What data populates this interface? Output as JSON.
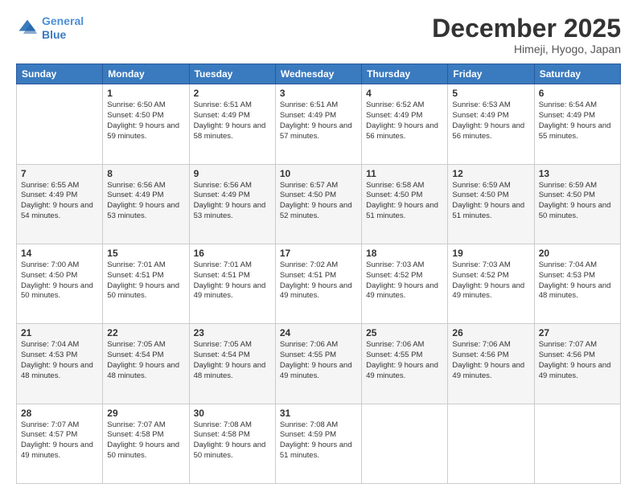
{
  "logo": {
    "line1": "General",
    "line2": "Blue"
  },
  "header": {
    "month": "December 2025",
    "location": "Himeji, Hyogo, Japan"
  },
  "weekdays": [
    "Sunday",
    "Monday",
    "Tuesday",
    "Wednesday",
    "Thursday",
    "Friday",
    "Saturday"
  ],
  "weeks": [
    [
      {
        "day": "",
        "sunrise": "",
        "sunset": "",
        "daylight": ""
      },
      {
        "day": "1",
        "sunrise": "Sunrise: 6:50 AM",
        "sunset": "Sunset: 4:50 PM",
        "daylight": "Daylight: 9 hours and 59 minutes."
      },
      {
        "day": "2",
        "sunrise": "Sunrise: 6:51 AM",
        "sunset": "Sunset: 4:49 PM",
        "daylight": "Daylight: 9 hours and 58 minutes."
      },
      {
        "day": "3",
        "sunrise": "Sunrise: 6:51 AM",
        "sunset": "Sunset: 4:49 PM",
        "daylight": "Daylight: 9 hours and 57 minutes."
      },
      {
        "day": "4",
        "sunrise": "Sunrise: 6:52 AM",
        "sunset": "Sunset: 4:49 PM",
        "daylight": "Daylight: 9 hours and 56 minutes."
      },
      {
        "day": "5",
        "sunrise": "Sunrise: 6:53 AM",
        "sunset": "Sunset: 4:49 PM",
        "daylight": "Daylight: 9 hours and 56 minutes."
      },
      {
        "day": "6",
        "sunrise": "Sunrise: 6:54 AM",
        "sunset": "Sunset: 4:49 PM",
        "daylight": "Daylight: 9 hours and 55 minutes."
      }
    ],
    [
      {
        "day": "7",
        "sunrise": "Sunrise: 6:55 AM",
        "sunset": "Sunset: 4:49 PM",
        "daylight": "Daylight: 9 hours and 54 minutes."
      },
      {
        "day": "8",
        "sunrise": "Sunrise: 6:56 AM",
        "sunset": "Sunset: 4:49 PM",
        "daylight": "Daylight: 9 hours and 53 minutes."
      },
      {
        "day": "9",
        "sunrise": "Sunrise: 6:56 AM",
        "sunset": "Sunset: 4:49 PM",
        "daylight": "Daylight: 9 hours and 53 minutes."
      },
      {
        "day": "10",
        "sunrise": "Sunrise: 6:57 AM",
        "sunset": "Sunset: 4:50 PM",
        "daylight": "Daylight: 9 hours and 52 minutes."
      },
      {
        "day": "11",
        "sunrise": "Sunrise: 6:58 AM",
        "sunset": "Sunset: 4:50 PM",
        "daylight": "Daylight: 9 hours and 51 minutes."
      },
      {
        "day": "12",
        "sunrise": "Sunrise: 6:59 AM",
        "sunset": "Sunset: 4:50 PM",
        "daylight": "Daylight: 9 hours and 51 minutes."
      },
      {
        "day": "13",
        "sunrise": "Sunrise: 6:59 AM",
        "sunset": "Sunset: 4:50 PM",
        "daylight": "Daylight: 9 hours and 50 minutes."
      }
    ],
    [
      {
        "day": "14",
        "sunrise": "Sunrise: 7:00 AM",
        "sunset": "Sunset: 4:50 PM",
        "daylight": "Daylight: 9 hours and 50 minutes."
      },
      {
        "day": "15",
        "sunrise": "Sunrise: 7:01 AM",
        "sunset": "Sunset: 4:51 PM",
        "daylight": "Daylight: 9 hours and 50 minutes."
      },
      {
        "day": "16",
        "sunrise": "Sunrise: 7:01 AM",
        "sunset": "Sunset: 4:51 PM",
        "daylight": "Daylight: 9 hours and 49 minutes."
      },
      {
        "day": "17",
        "sunrise": "Sunrise: 7:02 AM",
        "sunset": "Sunset: 4:51 PM",
        "daylight": "Daylight: 9 hours and 49 minutes."
      },
      {
        "day": "18",
        "sunrise": "Sunrise: 7:03 AM",
        "sunset": "Sunset: 4:52 PM",
        "daylight": "Daylight: 9 hours and 49 minutes."
      },
      {
        "day": "19",
        "sunrise": "Sunrise: 7:03 AM",
        "sunset": "Sunset: 4:52 PM",
        "daylight": "Daylight: 9 hours and 49 minutes."
      },
      {
        "day": "20",
        "sunrise": "Sunrise: 7:04 AM",
        "sunset": "Sunset: 4:53 PM",
        "daylight": "Daylight: 9 hours and 48 minutes."
      }
    ],
    [
      {
        "day": "21",
        "sunrise": "Sunrise: 7:04 AM",
        "sunset": "Sunset: 4:53 PM",
        "daylight": "Daylight: 9 hours and 48 minutes."
      },
      {
        "day": "22",
        "sunrise": "Sunrise: 7:05 AM",
        "sunset": "Sunset: 4:54 PM",
        "daylight": "Daylight: 9 hours and 48 minutes."
      },
      {
        "day": "23",
        "sunrise": "Sunrise: 7:05 AM",
        "sunset": "Sunset: 4:54 PM",
        "daylight": "Daylight: 9 hours and 48 minutes."
      },
      {
        "day": "24",
        "sunrise": "Sunrise: 7:06 AM",
        "sunset": "Sunset: 4:55 PM",
        "daylight": "Daylight: 9 hours and 49 minutes."
      },
      {
        "day": "25",
        "sunrise": "Sunrise: 7:06 AM",
        "sunset": "Sunset: 4:55 PM",
        "daylight": "Daylight: 9 hours and 49 minutes."
      },
      {
        "day": "26",
        "sunrise": "Sunrise: 7:06 AM",
        "sunset": "Sunset: 4:56 PM",
        "daylight": "Daylight: 9 hours and 49 minutes."
      },
      {
        "day": "27",
        "sunrise": "Sunrise: 7:07 AM",
        "sunset": "Sunset: 4:56 PM",
        "daylight": "Daylight: 9 hours and 49 minutes."
      }
    ],
    [
      {
        "day": "28",
        "sunrise": "Sunrise: 7:07 AM",
        "sunset": "Sunset: 4:57 PM",
        "daylight": "Daylight: 9 hours and 49 minutes."
      },
      {
        "day": "29",
        "sunrise": "Sunrise: 7:07 AM",
        "sunset": "Sunset: 4:58 PM",
        "daylight": "Daylight: 9 hours and 50 minutes."
      },
      {
        "day": "30",
        "sunrise": "Sunrise: 7:08 AM",
        "sunset": "Sunset: 4:58 PM",
        "daylight": "Daylight: 9 hours and 50 minutes."
      },
      {
        "day": "31",
        "sunrise": "Sunrise: 7:08 AM",
        "sunset": "Sunset: 4:59 PM",
        "daylight": "Daylight: 9 hours and 51 minutes."
      },
      {
        "day": "",
        "sunrise": "",
        "sunset": "",
        "daylight": ""
      },
      {
        "day": "",
        "sunrise": "",
        "sunset": "",
        "daylight": ""
      },
      {
        "day": "",
        "sunrise": "",
        "sunset": "",
        "daylight": ""
      }
    ]
  ]
}
